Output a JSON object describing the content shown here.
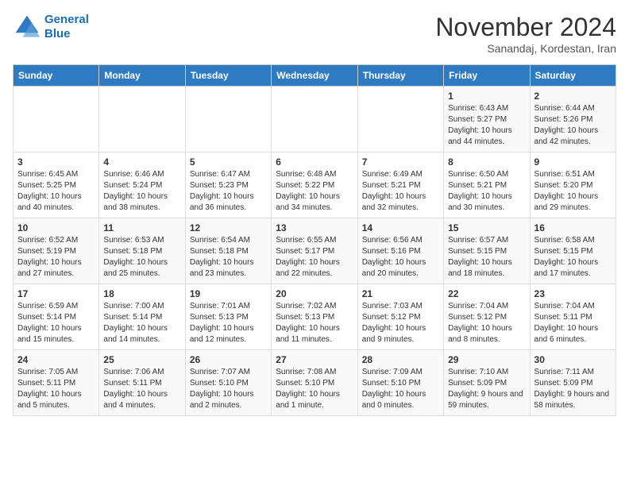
{
  "logo": {
    "line1": "General",
    "line2": "Blue"
  },
  "title": "November 2024",
  "location": "Sanandaj, Kordestan, Iran",
  "weekdays": [
    "Sunday",
    "Monday",
    "Tuesday",
    "Wednesday",
    "Thursday",
    "Friday",
    "Saturday"
  ],
  "weeks": [
    [
      {
        "day": "",
        "sunrise": "",
        "sunset": "",
        "daylight": ""
      },
      {
        "day": "",
        "sunrise": "",
        "sunset": "",
        "daylight": ""
      },
      {
        "day": "",
        "sunrise": "",
        "sunset": "",
        "daylight": ""
      },
      {
        "day": "",
        "sunrise": "",
        "sunset": "",
        "daylight": ""
      },
      {
        "day": "",
        "sunrise": "",
        "sunset": "",
        "daylight": ""
      },
      {
        "day": "1",
        "sunrise": "Sunrise: 6:43 AM",
        "sunset": "Sunset: 5:27 PM",
        "daylight": "Daylight: 10 hours and 44 minutes."
      },
      {
        "day": "2",
        "sunrise": "Sunrise: 6:44 AM",
        "sunset": "Sunset: 5:26 PM",
        "daylight": "Daylight: 10 hours and 42 minutes."
      }
    ],
    [
      {
        "day": "3",
        "sunrise": "Sunrise: 6:45 AM",
        "sunset": "Sunset: 5:25 PM",
        "daylight": "Daylight: 10 hours and 40 minutes."
      },
      {
        "day": "4",
        "sunrise": "Sunrise: 6:46 AM",
        "sunset": "Sunset: 5:24 PM",
        "daylight": "Daylight: 10 hours and 38 minutes."
      },
      {
        "day": "5",
        "sunrise": "Sunrise: 6:47 AM",
        "sunset": "Sunset: 5:23 PM",
        "daylight": "Daylight: 10 hours and 36 minutes."
      },
      {
        "day": "6",
        "sunrise": "Sunrise: 6:48 AM",
        "sunset": "Sunset: 5:22 PM",
        "daylight": "Daylight: 10 hours and 34 minutes."
      },
      {
        "day": "7",
        "sunrise": "Sunrise: 6:49 AM",
        "sunset": "Sunset: 5:21 PM",
        "daylight": "Daylight: 10 hours and 32 minutes."
      },
      {
        "day": "8",
        "sunrise": "Sunrise: 6:50 AM",
        "sunset": "Sunset: 5:21 PM",
        "daylight": "Daylight: 10 hours and 30 minutes."
      },
      {
        "day": "9",
        "sunrise": "Sunrise: 6:51 AM",
        "sunset": "Sunset: 5:20 PM",
        "daylight": "Daylight: 10 hours and 29 minutes."
      }
    ],
    [
      {
        "day": "10",
        "sunrise": "Sunrise: 6:52 AM",
        "sunset": "Sunset: 5:19 PM",
        "daylight": "Daylight: 10 hours and 27 minutes."
      },
      {
        "day": "11",
        "sunrise": "Sunrise: 6:53 AM",
        "sunset": "Sunset: 5:18 PM",
        "daylight": "Daylight: 10 hours and 25 minutes."
      },
      {
        "day": "12",
        "sunrise": "Sunrise: 6:54 AM",
        "sunset": "Sunset: 5:18 PM",
        "daylight": "Daylight: 10 hours and 23 minutes."
      },
      {
        "day": "13",
        "sunrise": "Sunrise: 6:55 AM",
        "sunset": "Sunset: 5:17 PM",
        "daylight": "Daylight: 10 hours and 22 minutes."
      },
      {
        "day": "14",
        "sunrise": "Sunrise: 6:56 AM",
        "sunset": "Sunset: 5:16 PM",
        "daylight": "Daylight: 10 hours and 20 minutes."
      },
      {
        "day": "15",
        "sunrise": "Sunrise: 6:57 AM",
        "sunset": "Sunset: 5:15 PM",
        "daylight": "Daylight: 10 hours and 18 minutes."
      },
      {
        "day": "16",
        "sunrise": "Sunrise: 6:58 AM",
        "sunset": "Sunset: 5:15 PM",
        "daylight": "Daylight: 10 hours and 17 minutes."
      }
    ],
    [
      {
        "day": "17",
        "sunrise": "Sunrise: 6:59 AM",
        "sunset": "Sunset: 5:14 PM",
        "daylight": "Daylight: 10 hours and 15 minutes."
      },
      {
        "day": "18",
        "sunrise": "Sunrise: 7:00 AM",
        "sunset": "Sunset: 5:14 PM",
        "daylight": "Daylight: 10 hours and 14 minutes."
      },
      {
        "day": "19",
        "sunrise": "Sunrise: 7:01 AM",
        "sunset": "Sunset: 5:13 PM",
        "daylight": "Daylight: 10 hours and 12 minutes."
      },
      {
        "day": "20",
        "sunrise": "Sunrise: 7:02 AM",
        "sunset": "Sunset: 5:13 PM",
        "daylight": "Daylight: 10 hours and 11 minutes."
      },
      {
        "day": "21",
        "sunrise": "Sunrise: 7:03 AM",
        "sunset": "Sunset: 5:12 PM",
        "daylight": "Daylight: 10 hours and 9 minutes."
      },
      {
        "day": "22",
        "sunrise": "Sunrise: 7:04 AM",
        "sunset": "Sunset: 5:12 PM",
        "daylight": "Daylight: 10 hours and 8 minutes."
      },
      {
        "day": "23",
        "sunrise": "Sunrise: 7:04 AM",
        "sunset": "Sunset: 5:11 PM",
        "daylight": "Daylight: 10 hours and 6 minutes."
      }
    ],
    [
      {
        "day": "24",
        "sunrise": "Sunrise: 7:05 AM",
        "sunset": "Sunset: 5:11 PM",
        "daylight": "Daylight: 10 hours and 5 minutes."
      },
      {
        "day": "25",
        "sunrise": "Sunrise: 7:06 AM",
        "sunset": "Sunset: 5:11 PM",
        "daylight": "Daylight: 10 hours and 4 minutes."
      },
      {
        "day": "26",
        "sunrise": "Sunrise: 7:07 AM",
        "sunset": "Sunset: 5:10 PM",
        "daylight": "Daylight: 10 hours and 2 minutes."
      },
      {
        "day": "27",
        "sunrise": "Sunrise: 7:08 AM",
        "sunset": "Sunset: 5:10 PM",
        "daylight": "Daylight: 10 hours and 1 minute."
      },
      {
        "day": "28",
        "sunrise": "Sunrise: 7:09 AM",
        "sunset": "Sunset: 5:10 PM",
        "daylight": "Daylight: 10 hours and 0 minutes."
      },
      {
        "day": "29",
        "sunrise": "Sunrise: 7:10 AM",
        "sunset": "Sunset: 5:09 PM",
        "daylight": "Daylight: 9 hours and 59 minutes."
      },
      {
        "day": "30",
        "sunrise": "Sunrise: 7:11 AM",
        "sunset": "Sunset: 5:09 PM",
        "daylight": "Daylight: 9 hours and 58 minutes."
      }
    ]
  ]
}
